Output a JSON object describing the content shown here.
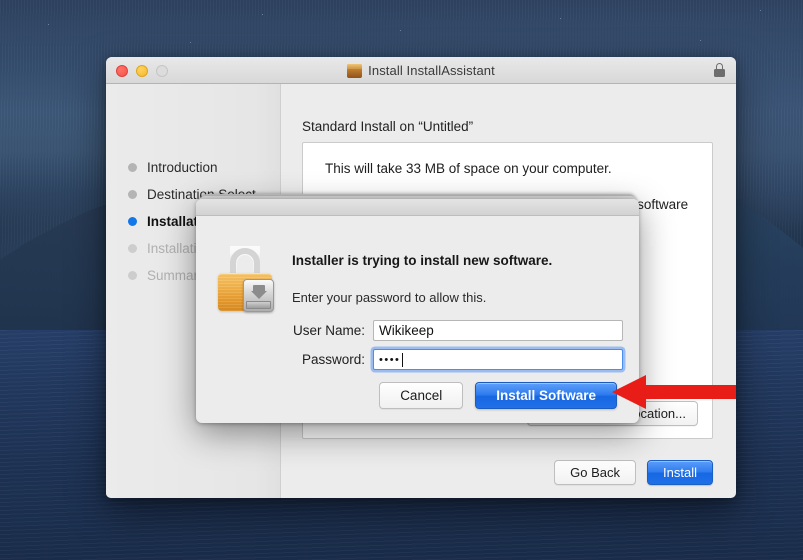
{
  "desktop": {
    "name": "macos-desktop-wallpaper"
  },
  "installer_window": {
    "title": "Install InstallAssistant",
    "pkg_icon": "package-icon",
    "lock_icon": "lock-icon",
    "traffic_lights": [
      "close-button",
      "minimize-button",
      "zoom-button-disabled"
    ],
    "sidebar": {
      "steps": [
        {
          "label": "Introduction",
          "state": "done"
        },
        {
          "label": "Destination Select",
          "state": "done"
        },
        {
          "label": "Installation Type",
          "state": "active"
        },
        {
          "label": "Installation",
          "state": "upcoming"
        },
        {
          "label": "Summary",
          "state": "upcoming"
        }
      ]
    },
    "pane": {
      "heading": "Standard Install on “Untitled”",
      "line1": "This will take 33 MB of space on your computer.",
      "line2": "Click Install to perform a standard installation of this software on the disk “Untitled”.",
      "change_location_label": "Change Install Location..."
    },
    "footer": {
      "go_back_label": "Go Back",
      "install_label": "Install"
    }
  },
  "auth_dialog": {
    "lock_icon": "padlock-with-disk-badge-icon",
    "headline": "Installer is trying to install new software.",
    "subtext": "Enter your password to allow this.",
    "username_label": "User Name:",
    "username_value": "Wikikeep",
    "username_placeholder": "",
    "password_label": "Password:",
    "password_value": "••••",
    "password_placeholder": "",
    "cancel_label": "Cancel",
    "confirm_label": "Install Software"
  },
  "annotation": {
    "arrow": "red-left-arrow-pointing-at-install-software",
    "color": "#e81d17"
  },
  "colors": {
    "accent_blue": "#2f7cf0",
    "active_step_dot": "#1277e8",
    "arrow_red": "#e81d17",
    "window_bg": "#ececec",
    "lock_yellow": "#f2b24b"
  }
}
